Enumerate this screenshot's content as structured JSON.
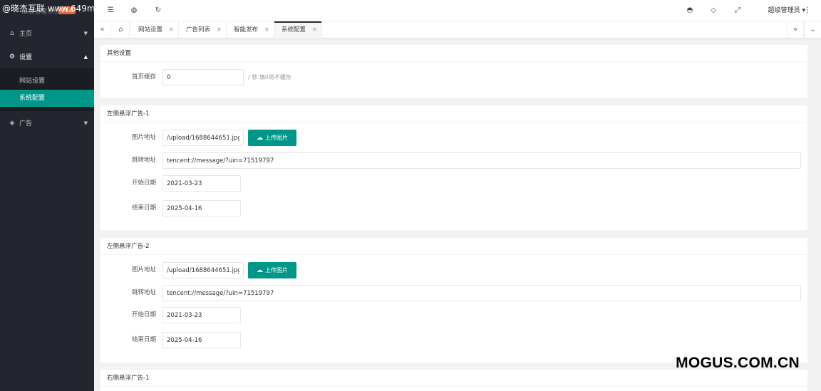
{
  "watermarks": {
    "top": "@晓杰互联 www.649m",
    "bottom": "MOGUS.COM.CN"
  },
  "sidebar": {
    "logo_text": "模板管理系统",
    "logo_badge": "V1.0",
    "items": [
      {
        "icon": "home-icon",
        "label": "主页",
        "expanded": false
      },
      {
        "icon": "gear-icon",
        "label": "设置",
        "expanded": true,
        "children": [
          {
            "label": "网站设置",
            "active": false
          },
          {
            "label": "系统配置",
            "active": true
          }
        ]
      },
      {
        "icon": "diamond-icon",
        "label": "广告",
        "expanded": false
      }
    ]
  },
  "header": {
    "icons": [
      "collapse-menu-icon",
      "globe-icon",
      "refresh-icon",
      "theme-icon",
      "tag-icon",
      "fullscreen-icon"
    ],
    "user": "超级管理员"
  },
  "tabs": [
    {
      "label": "网站设置",
      "active": false
    },
    {
      "label": "广告列表",
      "active": false
    },
    {
      "label": "智能发布",
      "active": false
    },
    {
      "label": "系统配置",
      "active": true
    }
  ],
  "sections": {
    "other": {
      "title": "其他设置",
      "cache_label": "首页缓存",
      "cache_value": "0",
      "cache_hint": "/ 秒 填0将不缓存"
    },
    "left1": {
      "title": "左侧悬浮广告-1",
      "image_label": "图片地址",
      "image_value": "/upload/1688644651.jpg",
      "upload_label": "上传图片",
      "link_label": "跳转地址",
      "link_value": "tencent://message/?uin=71519797",
      "start_label": "开始日期",
      "start_value": "2021-03-23",
      "end_label": "结束日期",
      "end_value": "2025-04-16"
    },
    "left2": {
      "title": "左侧悬浮广告-2",
      "image_label": "图片地址",
      "image_value": "/upload/1688644651.jpg",
      "upload_label": "上传图片",
      "link_label": "跳转地址",
      "link_value": "tencent://message/?uin=71519797",
      "start_label": "开始日期",
      "start_value": "2021-03-23",
      "end_label": "结束日期",
      "end_value": "2025-04-16"
    },
    "right1": {
      "title": "右侧悬浮广告-1"
    }
  },
  "colors": {
    "sidebar": "#23262e",
    "accent": "#009688",
    "badge": "#e8643b"
  }
}
